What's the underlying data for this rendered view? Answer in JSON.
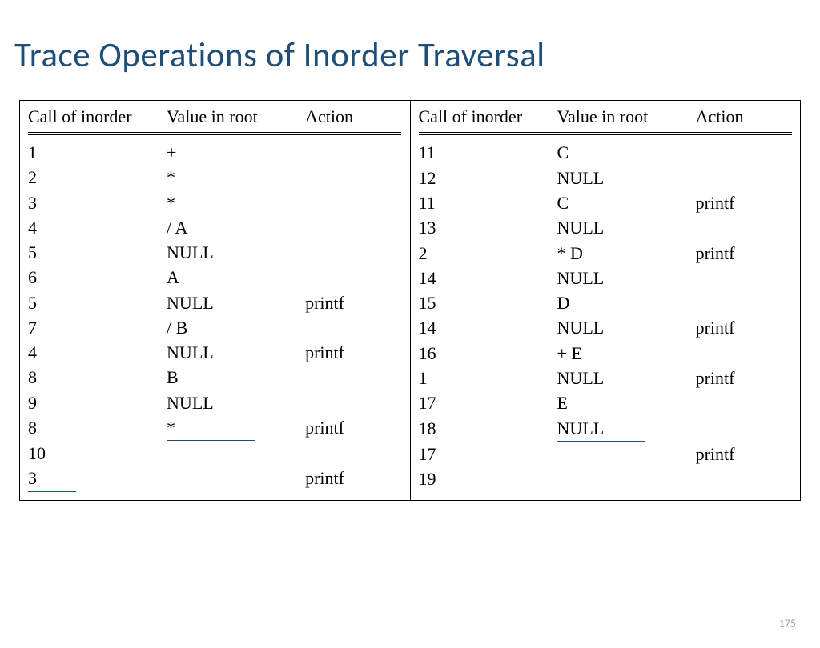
{
  "title": "Trace Operations of Inorder Traversal",
  "pageNumber": "175",
  "headers": {
    "call": "Call of inorder",
    "value": "Value in root",
    "action": "Action"
  },
  "leftRows": [
    {
      "call": "1",
      "value": "+",
      "action": ""
    },
    {
      "call": "2",
      "value": "*",
      "action": ""
    },
    {
      "call": "3",
      "value": "*",
      "action": ""
    },
    {
      "call": "4",
      "value": "/ A",
      "action": ""
    },
    {
      "call": "5",
      "value": "NULL",
      "action": ""
    },
    {
      "call": "6",
      "value": "A",
      "action": ""
    },
    {
      "call": "5",
      "value": "NULL",
      "action": "printf"
    },
    {
      "call": "7",
      "value": "/ B",
      "action": ""
    },
    {
      "call": "4",
      "value": "NULL",
      "action": "printf"
    },
    {
      "call": "8",
      "value": "B",
      "action": ""
    },
    {
      "call": "9",
      "value": "NULL",
      "action": ""
    },
    {
      "call": "8",
      "value": "*",
      "action": "printf",
      "underValue": true
    },
    {
      "call": "10",
      "value": "",
      "action": ""
    },
    {
      "call": "3",
      "value": "",
      "action": "printf",
      "underCall": true
    }
  ],
  "rightRows": [
    {
      "call": "11",
      "value": "C",
      "action": ""
    },
    {
      "call": "12",
      "value": "NULL",
      "action": ""
    },
    {
      "call": "11",
      "value": "C",
      "action": "printf"
    },
    {
      "call": "13",
      "value": "NULL",
      "action": ""
    },
    {
      "call": "2",
      "value": "* D",
      "action": "printf"
    },
    {
      "call": "14",
      "value": "NULL",
      "action": ""
    },
    {
      "call": "15",
      "value": "D",
      "action": ""
    },
    {
      "call": "14",
      "value": "NULL",
      "action": "printf"
    },
    {
      "call": "16",
      "value": "+ E",
      "action": ""
    },
    {
      "call": "1",
      "value": "NULL",
      "action": "printf"
    },
    {
      "call": "17",
      "value": "E",
      "action": ""
    },
    {
      "call": "18",
      "value": "NULL",
      "action": "",
      "underValue": true
    },
    {
      "call": "17",
      "value": "",
      "action": "printf"
    },
    {
      "call": "19",
      "value": "",
      "action": ""
    }
  ]
}
